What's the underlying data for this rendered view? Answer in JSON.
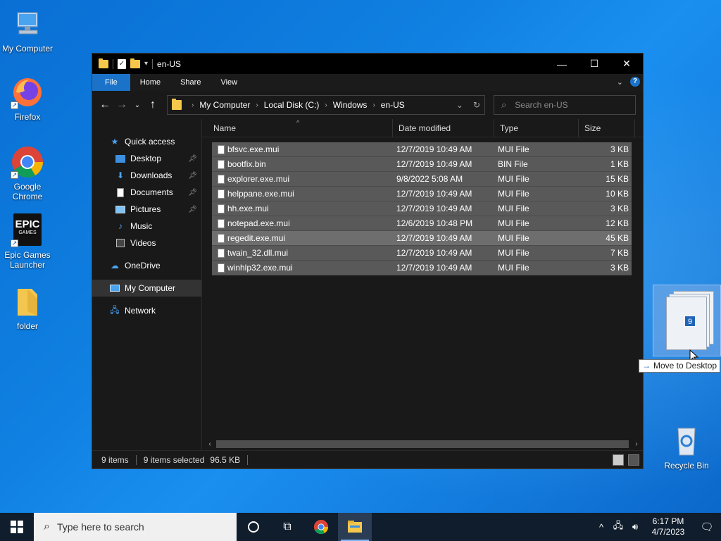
{
  "desktop": {
    "icons": [
      {
        "label": "My Computer"
      },
      {
        "label": "Firefox"
      },
      {
        "label": "Google Chrome"
      },
      {
        "label": "Epic Games Launcher",
        "logo_line1": "EPIC",
        "logo_line2": "GAMES"
      },
      {
        "label": "folder"
      },
      {
        "label": "Recycle Bin"
      }
    ]
  },
  "window": {
    "title": "en-US",
    "ribbon": {
      "tabs": [
        "File",
        "Home",
        "Share",
        "View"
      ]
    },
    "address": {
      "crumbs": [
        "My Computer",
        "Local Disk (C:)",
        "Windows",
        "en-US"
      ]
    },
    "search": {
      "placeholder": "Search en-US"
    },
    "nav": {
      "quick_access": "Quick access",
      "items": [
        {
          "label": "Desktop",
          "pinned": true
        },
        {
          "label": "Downloads",
          "pinned": true
        },
        {
          "label": "Documents",
          "pinned": true
        },
        {
          "label": "Pictures",
          "pinned": true
        },
        {
          "label": "Music",
          "pinned": false
        },
        {
          "label": "Videos",
          "pinned": false
        }
      ],
      "onedrive": "OneDrive",
      "my_computer": "My Computer",
      "network": "Network"
    },
    "columns": {
      "name": "Name",
      "date": "Date modified",
      "type": "Type",
      "size": "Size"
    },
    "files": [
      {
        "name": "bfsvc.exe.mui",
        "date": "12/7/2019 10:49 AM",
        "type": "MUI File",
        "size": "3 KB"
      },
      {
        "name": "bootfix.bin",
        "date": "12/7/2019 10:49 AM",
        "type": "BIN File",
        "size": "1 KB"
      },
      {
        "name": "explorer.exe.mui",
        "date": "9/8/2022 5:08 AM",
        "type": "MUI File",
        "size": "15 KB"
      },
      {
        "name": "helppane.exe.mui",
        "date": "12/7/2019 10:49 AM",
        "type": "MUI File",
        "size": "10 KB"
      },
      {
        "name": "hh.exe.mui",
        "date": "12/7/2019 10:49 AM",
        "type": "MUI File",
        "size": "3 KB"
      },
      {
        "name": "notepad.exe.mui",
        "date": "12/6/2019 10:48 PM",
        "type": "MUI File",
        "size": "12 KB"
      },
      {
        "name": "regedit.exe.mui",
        "date": "12/7/2019 10:49 AM",
        "type": "MUI File",
        "size": "45 KB"
      },
      {
        "name": "twain_32.dll.mui",
        "date": "12/7/2019 10:49 AM",
        "type": "MUI File",
        "size": "7 KB"
      },
      {
        "name": "winhlp32.exe.mui",
        "date": "12/7/2019 10:49 AM",
        "type": "MUI File",
        "size": "3 KB"
      }
    ],
    "status": {
      "items": "9 items",
      "selected": "9 items selected",
      "size": "96.5 KB"
    }
  },
  "drag": {
    "count": "9",
    "tooltip": "Move to Desktop"
  },
  "taskbar": {
    "search_placeholder": "Type here to search",
    "time": "6:17 PM",
    "date": "4/7/2023"
  },
  "colors": {
    "accent": "#1a73c9",
    "selection": "#595959",
    "taskbar": "#101d2c"
  }
}
